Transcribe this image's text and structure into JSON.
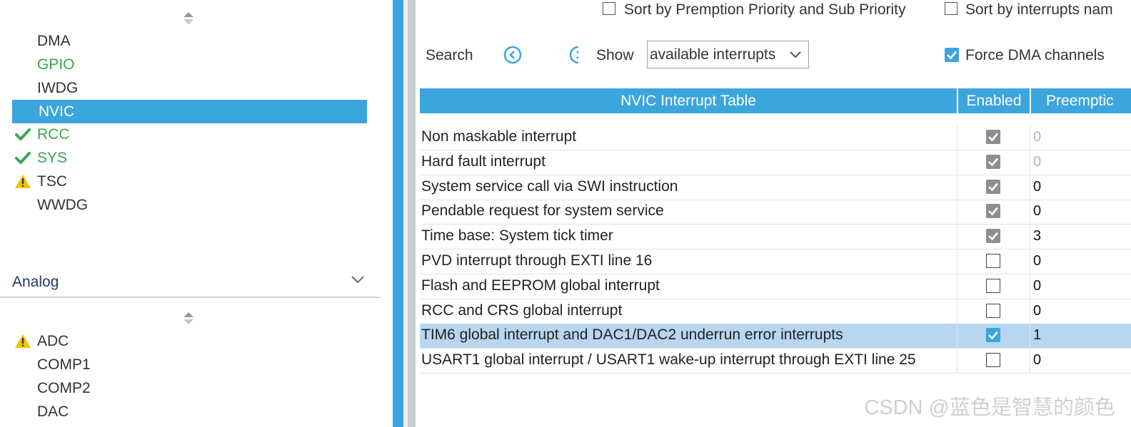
{
  "sidebar": {
    "items": [
      {
        "label": "DMA",
        "status": "none",
        "color": "#333333"
      },
      {
        "label": "GPIO",
        "status": "none",
        "color": "#36a852"
      },
      {
        "label": "IWDG",
        "status": "none",
        "color": "#333333"
      },
      {
        "label": "NVIC",
        "status": "selected",
        "color": "#ffffff"
      },
      {
        "label": "RCC",
        "status": "check",
        "color": "#36a852"
      },
      {
        "label": "SYS",
        "status": "check",
        "color": "#36a852"
      },
      {
        "label": "TSC",
        "status": "warning",
        "color": "#333333"
      },
      {
        "label": "WWDG",
        "status": "none",
        "color": "#333333"
      }
    ],
    "analog": {
      "title": "Analog",
      "items": [
        {
          "label": "ADC",
          "status": "warning"
        },
        {
          "label": "COMP1",
          "status": "none"
        },
        {
          "label": "COMP2",
          "status": "none"
        },
        {
          "label": "DAC",
          "status": "none"
        }
      ]
    }
  },
  "options": {
    "sort_priority_label": "Sort by Premption Priority and Sub Priority",
    "sort_priority_checked": false,
    "sort_name_label": "Sort by interrupts nam",
    "sort_name_checked": false,
    "search_label": "Search",
    "show_label": "Show",
    "show_value": "available interrupts",
    "force_dma_label": "Force DMA channels",
    "force_dma_checked": true
  },
  "table": {
    "title": "NVIC Interrupt Table",
    "col_enabled": "Enabled",
    "col_preemption": "Preemptic",
    "rows": [
      {
        "name": "Non maskable interrupt",
        "enabled": true,
        "locked": true,
        "priority": "0"
      },
      {
        "name": "Hard fault interrupt",
        "enabled": true,
        "locked": true,
        "priority": "0"
      },
      {
        "name": "System service call via SWI instruction",
        "enabled": true,
        "locked": true,
        "priority": "0"
      },
      {
        "name": "Pendable request for system service",
        "enabled": true,
        "locked": true,
        "priority": "0"
      },
      {
        "name": "Time base: System tick timer",
        "enabled": true,
        "locked": true,
        "priority": "3"
      },
      {
        "name": "PVD interrupt through EXTI line 16",
        "enabled": false,
        "locked": false,
        "priority": "0"
      },
      {
        "name": "Flash and EEPROM global interrupt",
        "enabled": false,
        "locked": false,
        "priority": "0"
      },
      {
        "name": "RCC and CRS global interrupt",
        "enabled": false,
        "locked": false,
        "priority": "0"
      },
      {
        "name": "TIM6 global interrupt and DAC1/DAC2 underrun error interrupts",
        "enabled": true,
        "locked": false,
        "priority": "1",
        "selected": true
      },
      {
        "name": "USART1 global interrupt / USART1 wake-up interrupt through EXTI line 25",
        "enabled": false,
        "locked": false,
        "priority": "0"
      }
    ]
  },
  "watermark": "CSDN @蓝色是智慧的颜色",
  "colors": {
    "accent": "#3ba5de",
    "ok": "#36a852",
    "warning": "#f5c400",
    "row_selected": "#b8d6ef"
  }
}
